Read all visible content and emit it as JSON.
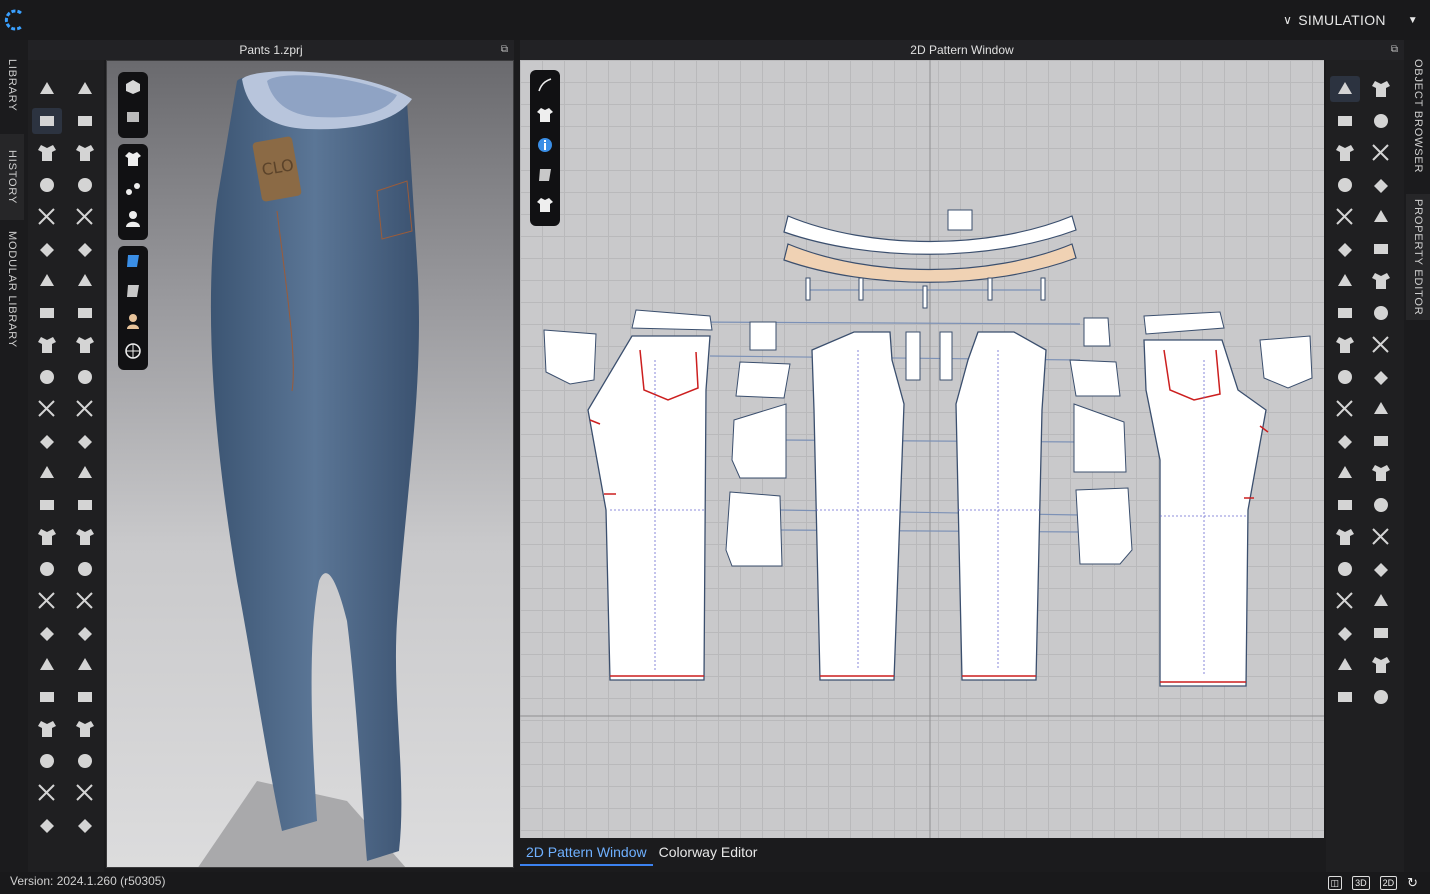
{
  "app": {
    "simulation_label": "SIMULATION",
    "version": "Version: 2024.1.260 (r50305)"
  },
  "left_tabs": [
    "LIBRARY",
    "HISTORY",
    "MODULAR LIBRARY"
  ],
  "right_tabs": [
    "OBJECT BROWSER",
    "PROPERTY EDITOR"
  ],
  "panel_3d": {
    "title": "Pants 1.zprj"
  },
  "panel_2d": {
    "title": "2D Pattern Window"
  },
  "bottom_tabs": [
    {
      "label": "2D Pattern Window",
      "active": true
    },
    {
      "label": "Colorway Editor",
      "active": false
    }
  ],
  "status_icons": [
    "split-view-icon",
    "3d-view-icon",
    "2d-view-icon",
    "refresh-icon"
  ],
  "status_labels": {
    "three_d": "3D",
    "two_d": "2D"
  },
  "colors": {
    "accent": "#3c82f0",
    "denim": "#4b6584",
    "pattern_red": "#cc1f1f",
    "waistband_tan": "#f0d2b4"
  }
}
